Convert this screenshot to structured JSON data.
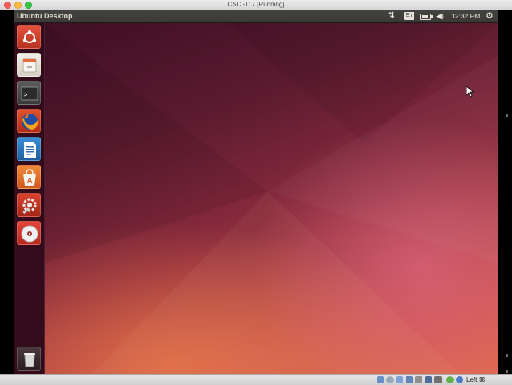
{
  "host_window": {
    "title": "CSCI-117 [Running]",
    "host_key_label": "Left ⌘"
  },
  "top_panel": {
    "title": "Ubuntu Desktop",
    "keyboard_layout": "En",
    "clock": "12:32 PM",
    "network_icon": "network-transfer-icon",
    "battery_icon": "battery-icon",
    "sound_icon": "speaker-icon",
    "session_icon": "gear-icon"
  },
  "launcher": {
    "items": [
      {
        "id": "dash",
        "icon": "ubuntu-dash-icon"
      },
      {
        "id": "files",
        "icon": "files-icon"
      },
      {
        "id": "terminal",
        "icon": "terminal-icon",
        "text": ">_"
      },
      {
        "id": "firefox",
        "icon": "firefox-icon"
      },
      {
        "id": "writer",
        "icon": "libreoffice-writer-icon"
      },
      {
        "id": "software",
        "icon": "software-center-icon",
        "text": "A"
      },
      {
        "id": "settings",
        "icon": "system-settings-icon"
      },
      {
        "id": "dvd",
        "icon": "optical-disc-icon"
      }
    ],
    "trash_icon": "trash-icon"
  },
  "colors": {
    "panel": "#3a3935",
    "launcher": "#370c1c",
    "wallpaper_dark": "#3f0f24",
    "wallpaper_light": "#e06a4f"
  }
}
